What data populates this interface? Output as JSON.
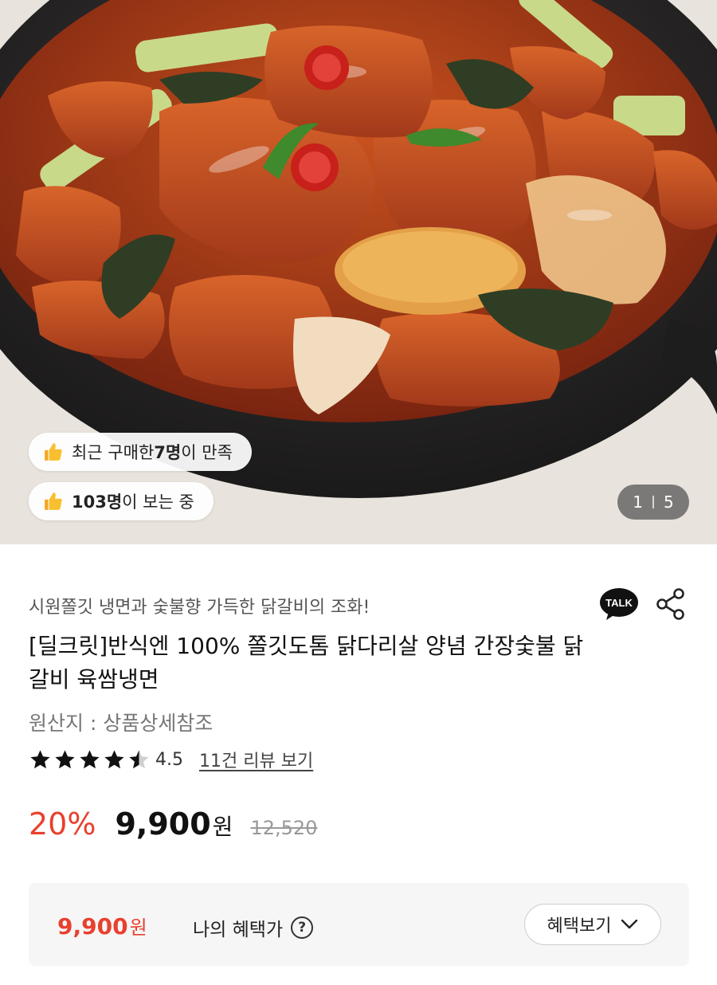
{
  "hero": {
    "badge_recent": {
      "prefix": "최근 구매한 ",
      "count": "7명",
      "suffix": "이 만족"
    },
    "badge_viewing": {
      "count": "103명",
      "suffix": "이 보는 중"
    },
    "counter": {
      "current": "1",
      "total": "5"
    }
  },
  "product": {
    "subtitle": "시원쫄깃 냉면과 숯불향 가득한 닭갈비의 조화!",
    "title": "[딜크릿]반식엔 100% 쫄깃도톰 닭다리살 양념 간장숯불 닭갈비 육쌈냉면",
    "origin": "원산지 : 상품상세참조",
    "rating": {
      "stars": 4.5,
      "score": "4.5",
      "review_link": "11건 리뷰 보기"
    },
    "talk_label": "TALK"
  },
  "price": {
    "discount": "20%",
    "sale": "9,900",
    "currency": "원",
    "original": "12,520",
    "accent_color": "#e8402e"
  },
  "benefit": {
    "price": "9,900",
    "currency": "원",
    "label": "나의 혜택가",
    "help_icon": "?",
    "button_label": "혜택보기"
  }
}
